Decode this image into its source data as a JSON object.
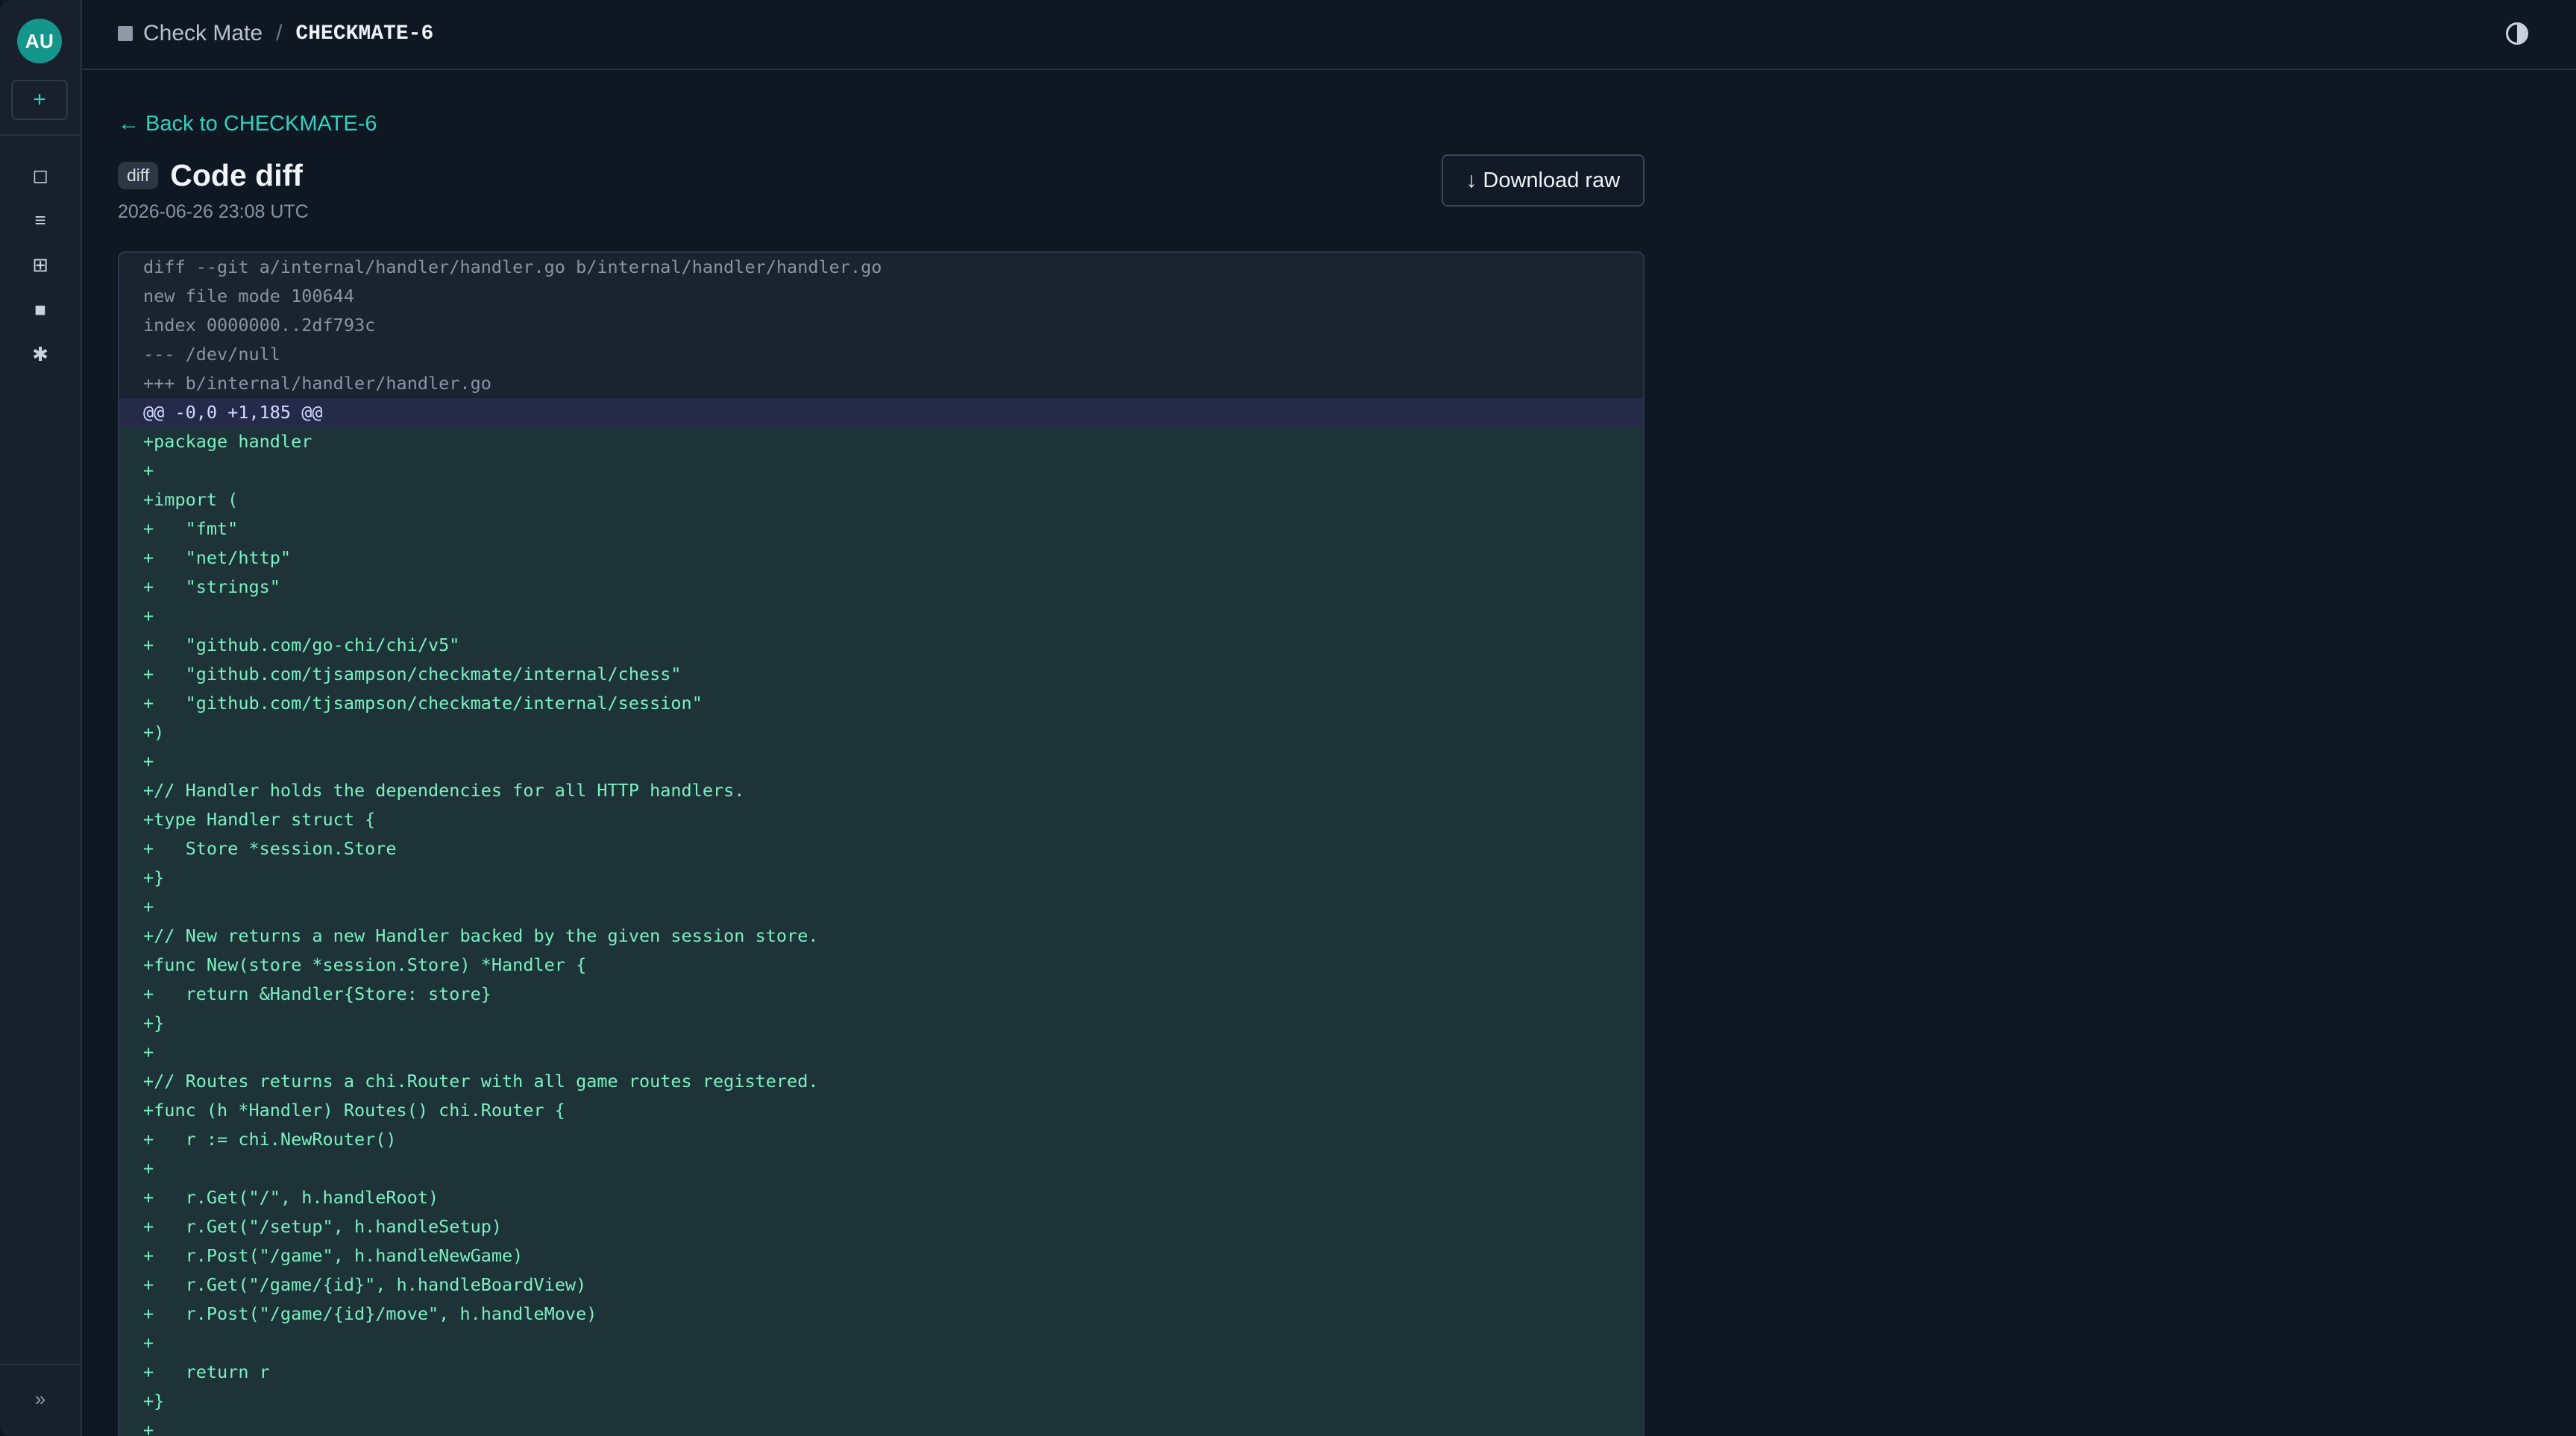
{
  "sidebar": {
    "avatar_initials": "AU",
    "new_label": "+",
    "nav_items": [
      {
        "icon": "square-outline-icon",
        "glyph": "◻"
      },
      {
        "icon": "list-icon",
        "glyph": "≡"
      },
      {
        "icon": "grid-icon",
        "glyph": "⊞"
      },
      {
        "icon": "filled-square-icon",
        "glyph": "■"
      },
      {
        "icon": "asterisk-icon",
        "glyph": "✱"
      }
    ],
    "collapse_glyph": "»"
  },
  "header": {
    "breadcrumb": {
      "project": "Check Mate",
      "separator": "/",
      "current": "CHECKMATE-6"
    }
  },
  "page": {
    "back_link": "← Back to CHECKMATE-6",
    "badge": "diff",
    "title": "Code diff",
    "timestamp": "2026-06-26 23:08 UTC",
    "download_label": "↓ Download raw"
  },
  "colors": {
    "accent": "#2fd2bd",
    "background": "#0f1722",
    "sidebar": "#17202c",
    "added_line_bg": "#1d3338",
    "added_line_text": "#7cf0c2",
    "hunk_bg": "#252a48"
  },
  "diff": {
    "lines": [
      {
        "type": "meta",
        "text": "diff --git a/internal/handler/handler.go b/internal/handler/handler.go"
      },
      {
        "type": "meta",
        "text": "new file mode 100644"
      },
      {
        "type": "meta",
        "text": "index 0000000..2df793c"
      },
      {
        "type": "meta",
        "text": "--- /dev/null"
      },
      {
        "type": "meta",
        "text": "+++ b/internal/handler/handler.go"
      },
      {
        "type": "hunk",
        "text": "@@ -0,0 +1,185 @@"
      },
      {
        "type": "add",
        "text": "+package handler"
      },
      {
        "type": "add",
        "text": "+"
      },
      {
        "type": "add",
        "text": "+import ("
      },
      {
        "type": "add",
        "text": "+   \"fmt\""
      },
      {
        "type": "add",
        "text": "+   \"net/http\""
      },
      {
        "type": "add",
        "text": "+   \"strings\""
      },
      {
        "type": "add",
        "text": "+"
      },
      {
        "type": "add",
        "text": "+   \"github.com/go-chi/chi/v5\""
      },
      {
        "type": "add",
        "text": "+   \"github.com/tjsampson/checkmate/internal/chess\""
      },
      {
        "type": "add",
        "text": "+   \"github.com/tjsampson/checkmate/internal/session\""
      },
      {
        "type": "add",
        "text": "+)"
      },
      {
        "type": "add",
        "text": "+"
      },
      {
        "type": "add",
        "text": "+// Handler holds the dependencies for all HTTP handlers."
      },
      {
        "type": "add",
        "text": "+type Handler struct {"
      },
      {
        "type": "add",
        "text": "+   Store *session.Store"
      },
      {
        "type": "add",
        "text": "+}"
      },
      {
        "type": "add",
        "text": "+"
      },
      {
        "type": "add",
        "text": "+// New returns a new Handler backed by the given session store."
      },
      {
        "type": "add",
        "text": "+func New(store *session.Store) *Handler {"
      },
      {
        "type": "add",
        "text": "+   return &Handler{Store: store}"
      },
      {
        "type": "add",
        "text": "+}"
      },
      {
        "type": "add",
        "text": "+"
      },
      {
        "type": "add",
        "text": "+// Routes returns a chi.Router with all game routes registered."
      },
      {
        "type": "add",
        "text": "+func (h *Handler) Routes() chi.Router {"
      },
      {
        "type": "add",
        "text": "+   r := chi.NewRouter()"
      },
      {
        "type": "add",
        "text": "+"
      },
      {
        "type": "add",
        "text": "+   r.Get(\"/\", h.handleRoot)"
      },
      {
        "type": "add",
        "text": "+   r.Get(\"/setup\", h.handleSetup)"
      },
      {
        "type": "add",
        "text": "+   r.Post(\"/game\", h.handleNewGame)"
      },
      {
        "type": "add",
        "text": "+   r.Get(\"/game/{id}\", h.handleBoardView)"
      },
      {
        "type": "add",
        "text": "+   r.Post(\"/game/{id}/move\", h.handleMove)"
      },
      {
        "type": "add",
        "text": "+"
      },
      {
        "type": "add",
        "text": "+   return r"
      },
      {
        "type": "add",
        "text": "+}"
      },
      {
        "type": "add",
        "text": "+"
      }
    ]
  }
}
